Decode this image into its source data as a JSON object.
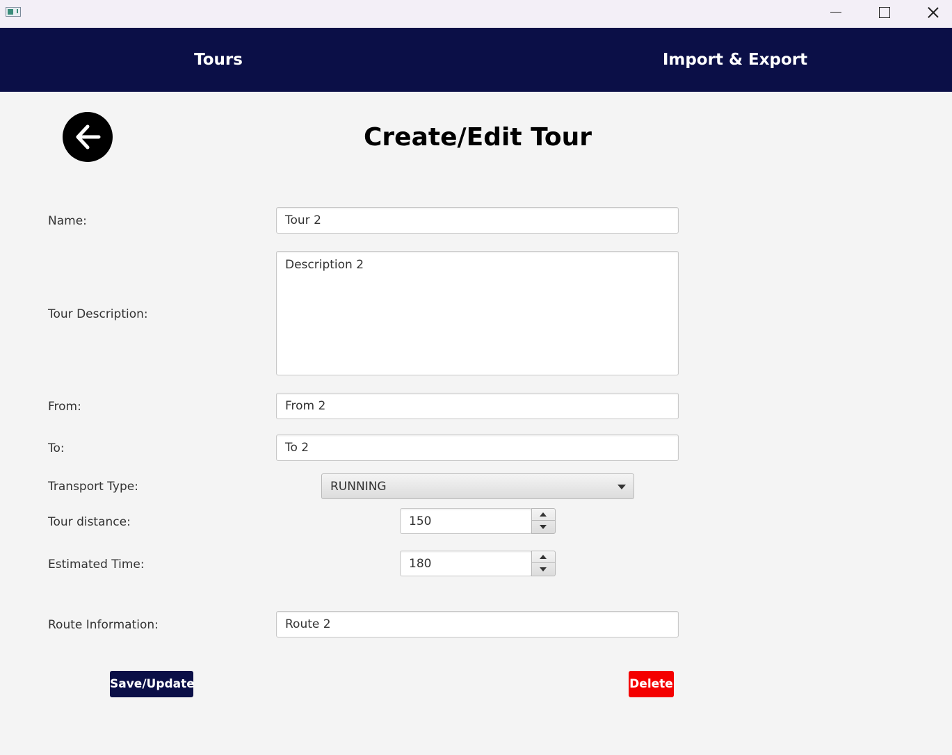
{
  "nav": {
    "tours_label": "Tours",
    "import_export_label": "Import & Export"
  },
  "page": {
    "title": "Create/Edit Tour"
  },
  "form": {
    "name_label": "Name:",
    "name_value": "Tour 2",
    "description_label": "Tour Description:",
    "description_value": "Description 2",
    "from_label": "From:",
    "from_value": "From 2",
    "to_label": "To:",
    "to_value": "To 2",
    "transport_label": "Transport Type:",
    "transport_value": "RUNNING",
    "distance_label": "Tour distance:",
    "distance_value": "150",
    "time_label": "Estimated Time:",
    "time_value": "180",
    "route_label": "Route Information:",
    "route_value": "Route 2"
  },
  "actions": {
    "save_label": "Save/Update",
    "delete_label": "Delete"
  },
  "colors": {
    "nav_bg": "#0b0f47",
    "save_bg": "#0b0f47",
    "delete_bg": "#f40000"
  },
  "icons": {
    "back": "arrow-left-icon",
    "dropdown": "chevron-down-icon"
  }
}
